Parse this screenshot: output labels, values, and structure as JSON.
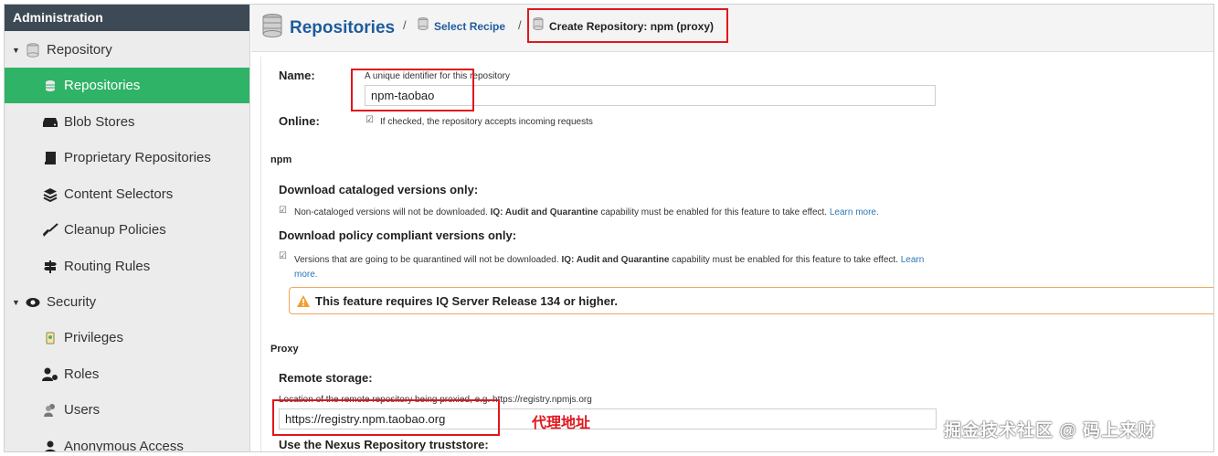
{
  "sidebar": {
    "header": "Administration",
    "items": [
      {
        "label": "Repository",
        "icon": "database-icon",
        "type": "group"
      },
      {
        "label": "Repositories",
        "icon": "database-icon",
        "type": "child",
        "active": true
      },
      {
        "label": "Blob Stores",
        "icon": "hard-drive-icon",
        "type": "child"
      },
      {
        "label": "Proprietary Repositories",
        "icon": "book-icon",
        "type": "child"
      },
      {
        "label": "Content Selectors",
        "icon": "layers-icon",
        "type": "child"
      },
      {
        "label": "Cleanup Policies",
        "icon": "broom-icon",
        "type": "child"
      },
      {
        "label": "Routing Rules",
        "icon": "signpost-icon",
        "type": "child"
      },
      {
        "label": "Security",
        "icon": "eye-icon",
        "type": "group"
      },
      {
        "label": "Privileges",
        "icon": "certificate-icon",
        "type": "child"
      },
      {
        "label": "Roles",
        "icon": "roles-icon",
        "type": "child"
      },
      {
        "label": "Users",
        "icon": "users-icon",
        "type": "child"
      },
      {
        "label": "Anonymous Access",
        "icon": "person-icon",
        "type": "child"
      }
    ]
  },
  "breadcrumb": {
    "title": "Repositories",
    "sep1": "/",
    "link": "Select Recipe",
    "sep2": "/",
    "current": "Create Repository: npm (proxy)"
  },
  "form": {
    "name_label": "Name:",
    "name_help": "A unique identifier for this repository",
    "name_value": "npm-taobao",
    "online_label": "Online:",
    "online_help": "If checked, the repository accepts incoming requests",
    "npm_section": "npm",
    "catalog_label": "Download cataloged versions only:",
    "catalog_help_1": "Non-cataloged versions will not be downloaded.",
    "catalog_help_bold": "IQ: Audit and Quarantine",
    "catalog_help_2": "capability must be enabled for this feature to take effect.",
    "catalog_learn": "Learn more.",
    "policy_label": "Download policy compliant versions only:",
    "policy_help_1": "Versions that are going to be quarantined will not be downloaded.",
    "policy_help_bold": "IQ: Audit and Quarantine",
    "policy_help_2": "capability must be enabled for this feature to take",
    "policy_help_3": "effect.",
    "policy_learn": "Learn more.",
    "warning": "This feature requires IQ Server Release 134 or higher.",
    "proxy_section": "Proxy",
    "remote_label": "Remote storage:",
    "remote_help": "Location of the remote repository being proxied, e.g. https://registry.npmjs.org",
    "remote_value": "https://registry.npm.taobao.org",
    "truststore_label": "Use the Nexus Repository truststore:"
  },
  "annotation": "代理地址",
  "watermark": "掘金技术社区 @ 码上来财",
  "colors": {
    "accent": "#2fb366",
    "header": "#3d4a56",
    "link": "#1f5c9b",
    "highlight": "#e0161b"
  }
}
